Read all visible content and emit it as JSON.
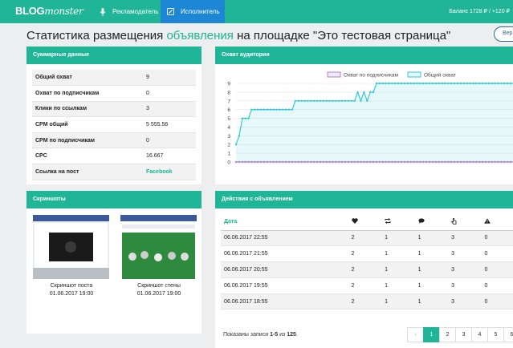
{
  "topbar": {
    "logo_bold": "BLOG",
    "logo_italic": "monster",
    "nav_advertiser": "Рекламодатель",
    "nav_executor": "Исполнитель",
    "balance": "Баланс 1728 ₽ / +120 ₽"
  },
  "page": {
    "title_prefix": "Статистика размещения ",
    "title_accent": "объявления",
    "title_suffix": " на площадке \"Это тестовая страница\"",
    "ver_button": "Вер"
  },
  "summary": {
    "title": "Суммарные данные",
    "rows": [
      {
        "label": "Общий охват",
        "value": "9"
      },
      {
        "label": "Охват по подписчикам",
        "value": "0"
      },
      {
        "label": "Клики по ссылкам",
        "value": "3"
      },
      {
        "label": "CPM общий",
        "value": "5 555.56"
      },
      {
        "label": "CPM по подписчикам",
        "value": "0"
      },
      {
        "label": "CPC",
        "value": "16.667"
      },
      {
        "label": "Ссылка на пост",
        "value": "Facebook"
      }
    ]
  },
  "reach": {
    "title": "Охват аудитории"
  },
  "chart_data": {
    "type": "line",
    "legend_position": "top",
    "grid": true,
    "ylim": [
      0,
      9
    ],
    "yticks": [
      "0",
      "1",
      "2",
      "3",
      "4",
      "5",
      "6",
      "7",
      "8",
      "9"
    ],
    "series": [
      {
        "name": "Охват по подписчикам",
        "color": "#b57edc",
        "values": [
          0,
          0,
          0,
          0,
          0,
          0,
          0,
          0,
          0,
          0,
          0,
          0,
          0,
          0,
          0,
          0,
          0,
          0,
          0,
          0,
          0,
          0,
          0,
          0,
          0,
          0,
          0,
          0,
          0,
          0,
          0,
          0,
          0,
          0,
          0,
          0,
          0,
          0,
          0,
          0,
          0,
          0,
          0,
          0,
          0,
          0,
          0,
          0,
          0,
          0,
          0,
          0,
          0,
          0,
          0,
          0,
          0,
          0,
          0,
          0,
          0,
          0,
          0,
          0,
          0,
          0,
          0,
          0,
          0,
          0,
          0,
          0,
          0,
          0,
          0,
          0,
          0,
          0,
          0,
          0,
          0,
          0,
          0,
          0,
          0,
          0,
          0,
          0,
          0,
          0
        ]
      },
      {
        "name": "Общий охват",
        "color": "#33c9d6",
        "values": [
          2,
          3,
          5,
          5,
          5,
          6,
          6,
          6,
          6,
          6,
          6,
          6,
          6,
          6,
          6,
          6,
          6,
          6,
          6,
          7,
          7,
          7,
          7,
          7,
          7,
          7,
          7,
          7,
          7,
          7,
          7,
          7,
          7,
          7,
          7,
          7,
          7,
          7,
          7,
          8,
          7,
          8,
          7,
          8,
          8,
          9,
          9,
          9,
          9,
          9,
          9,
          9,
          9,
          9,
          9,
          9,
          9,
          9,
          9,
          9,
          9,
          9,
          9,
          9,
          9,
          9,
          9,
          9,
          9,
          9,
          9,
          9,
          9,
          9,
          9,
          9,
          9,
          9,
          9,
          9,
          9,
          9,
          9,
          9,
          9,
          9,
          9,
          9,
          9,
          9
        ]
      }
    ]
  },
  "screenshots": {
    "title": "Скриншоты",
    "items": [
      {
        "caption": "Скриншот поста",
        "date": "01.06.2017 19:00"
      },
      {
        "caption": "Скриншот стены",
        "date": "01.06.2017 19:00"
      }
    ]
  },
  "actions": {
    "title": "Действия с объявлением",
    "header_date": "Дата",
    "rows": [
      {
        "date": "06.06.2017 22:55",
        "likes": "2",
        "reposts": "1",
        "comments": "1",
        "clicks": "3",
        "complaints": "0"
      },
      {
        "date": "06.06.2017 21:55",
        "likes": "2",
        "reposts": "1",
        "comments": "1",
        "clicks": "3",
        "complaints": "0"
      },
      {
        "date": "06.06.2017 20:55",
        "likes": "2",
        "reposts": "1",
        "comments": "1",
        "clicks": "3",
        "complaints": "0"
      },
      {
        "date": "06.06.2017 19:55",
        "likes": "2",
        "reposts": "1",
        "comments": "1",
        "clicks": "3",
        "complaints": "0"
      },
      {
        "date": "06.06.2017 18:55",
        "likes": "2",
        "reposts": "1",
        "comments": "1",
        "clicks": "3",
        "complaints": "0"
      }
    ],
    "records_prefix": "Показаны записи ",
    "records_range": "1-5",
    "records_mid": " из ",
    "records_total": "125",
    "records_suffix": ".",
    "pager": [
      "‹",
      "1",
      "2",
      "3",
      "4",
      "5",
      "6",
      "7"
    ]
  },
  "colors": {
    "accent": "#1fb596",
    "nav_active": "#1d87d6"
  }
}
